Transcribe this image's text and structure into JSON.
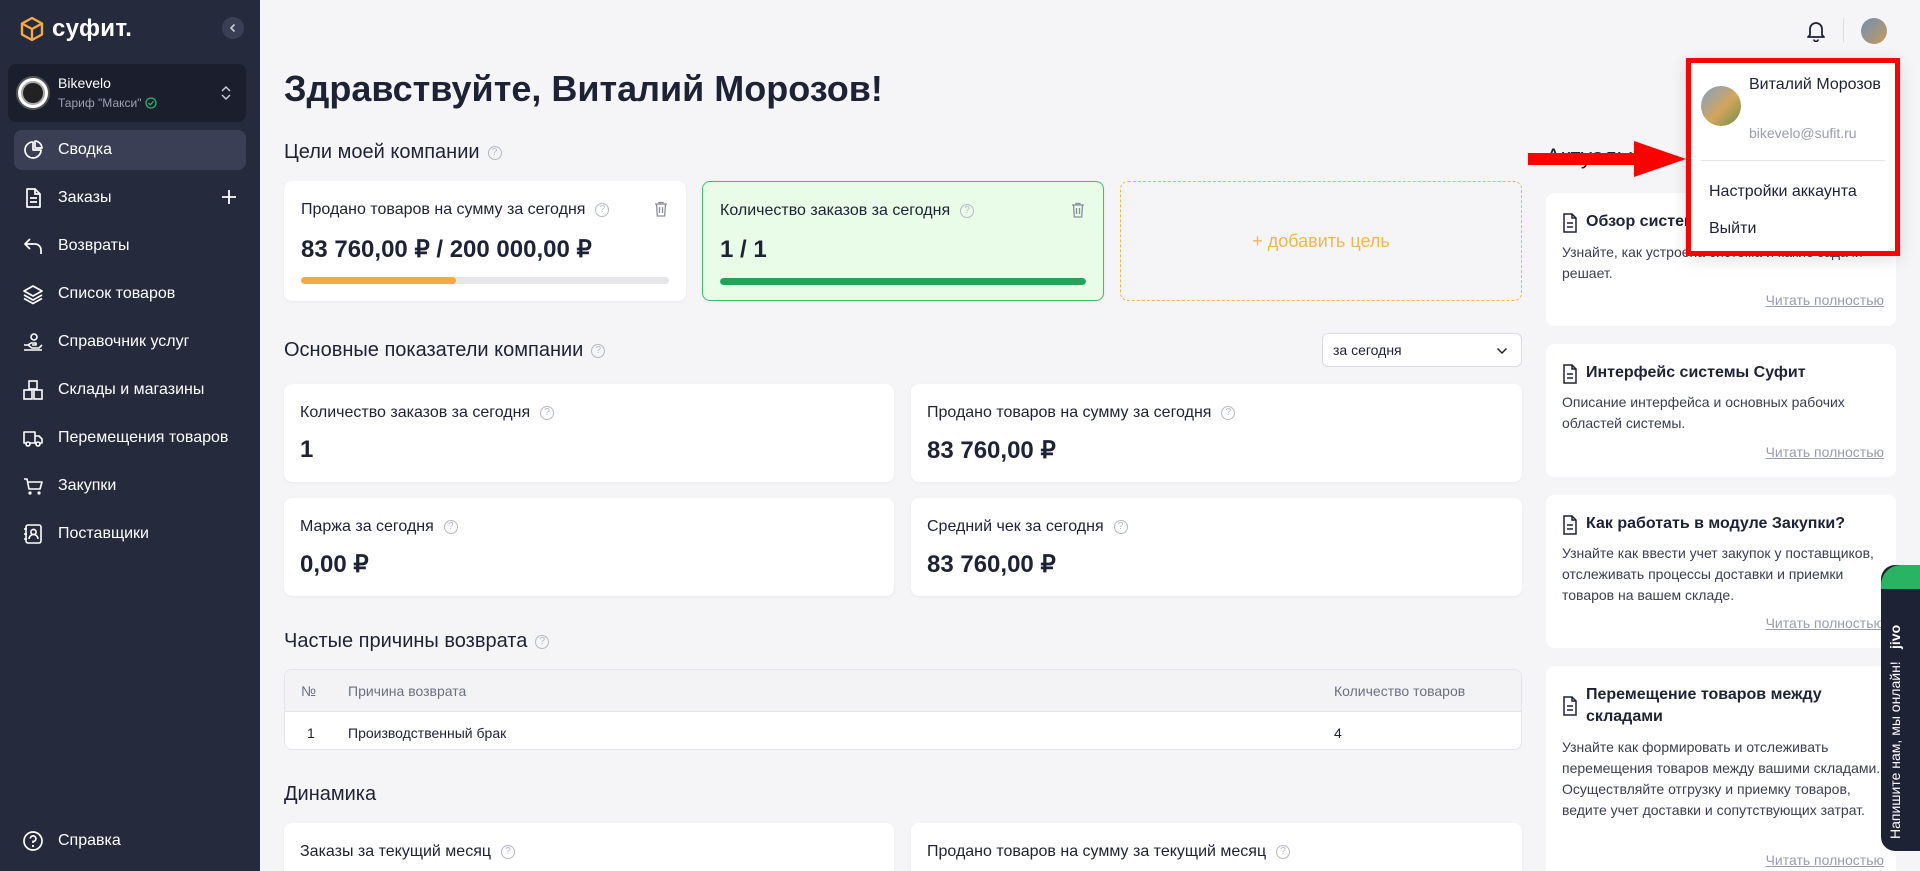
{
  "sidebar": {
    "logo_text": "суфит.",
    "company": {
      "name": "Bikevelo",
      "plan": "Тариф \"Макси\""
    },
    "items": [
      {
        "label": "Сводка",
        "icon": "pie-chart-icon"
      },
      {
        "label": "Заказы",
        "icon": "document-icon"
      },
      {
        "label": "Возвраты",
        "icon": "return-icon"
      },
      {
        "label": "Список товаров",
        "icon": "layers-icon"
      },
      {
        "label": "Справочник услуг",
        "icon": "service-hand-icon"
      },
      {
        "label": "Склады и магазины",
        "icon": "boxes-icon"
      },
      {
        "label": "Перемещения товаров",
        "icon": "truck-icon"
      },
      {
        "label": "Закупки",
        "icon": "cart-icon"
      },
      {
        "label": "Поставщики",
        "icon": "contacts-icon"
      }
    ],
    "help": "Справка"
  },
  "greeting": "Здравствуйте, Виталий Морозов!",
  "goals": {
    "title": "Цели моей компании",
    "cards": [
      {
        "label": "Продано товаров на сумму за сегодня",
        "value": "83 760,00 ₽ / 200 000,00 ₽",
        "progress": 0.42,
        "color": "#f5a940"
      },
      {
        "label": "Количество заказов за сегодня",
        "value": "1 / 1",
        "progress": 1.0,
        "color": "#22a559"
      }
    ],
    "add_label": "+ добавить цель"
  },
  "metrics": {
    "title": "Основные показатели компании",
    "period": "за сегодня",
    "cards": [
      {
        "label": "Количество заказов за сегодня",
        "value": "1"
      },
      {
        "label": "Продано товаров на сумму за сегодня",
        "value": "83 760,00 ₽"
      },
      {
        "label": "Маржа за сегодня",
        "value": "0,00 ₽"
      },
      {
        "label": "Средний чек за сегодня",
        "value": "83 760,00 ₽"
      }
    ]
  },
  "returns": {
    "title": "Частые причины возврата",
    "columns": [
      "№",
      "Причина возврата",
      "Количество товаров"
    ],
    "rows": [
      [
        "1",
        "Производственный брак",
        "4"
      ]
    ]
  },
  "dynamics": {
    "title": "Динамика",
    "cards": [
      "Заказы за текущий месяц",
      "Продано товаров на сумму за текущий месяц"
    ]
  },
  "articles": {
    "title_partial": "Актуальное",
    "items": [
      {
        "title": "Обзор системы",
        "desc": "Узнайте, как устроена система и какие задачи решает.",
        "link": "Читать полностью"
      },
      {
        "title": "Интерфейс системы Суфит",
        "desc": "Описание интерфейса и основных рабочих областей системы.",
        "link": "Читать полностью"
      },
      {
        "title": "Как работать в модуле Закупки?",
        "desc": "Узнайте как ввести учет закупок у поставщиков, отслеживать процессы доставки и приемки товаров на вашем складе.",
        "link": "Читать полностью"
      },
      {
        "title": "Перемещение товаров между складами",
        "desc": "Узнайте как формировать и отслеживать перемещения товаров между вашими складами. Осуществляйте отгрузку и приемку товаров, ведите учет доставки и сопутствующих затрат.",
        "link": "Читать полностью"
      }
    ]
  },
  "user_menu": {
    "name": "Виталий Морозов",
    "email": "bikevelo@sufit.ru",
    "items": [
      "Настройки аккаунта",
      "Выйти"
    ]
  },
  "chat_widget": {
    "label": "Напишите нам, мы онлайн!",
    "brand": "jivo"
  },
  "colors": {
    "sidebar_bg": "#262a3d",
    "accent_orange": "#f5a940",
    "accent_green": "#22a559",
    "highlight_red": "#ff0000"
  }
}
